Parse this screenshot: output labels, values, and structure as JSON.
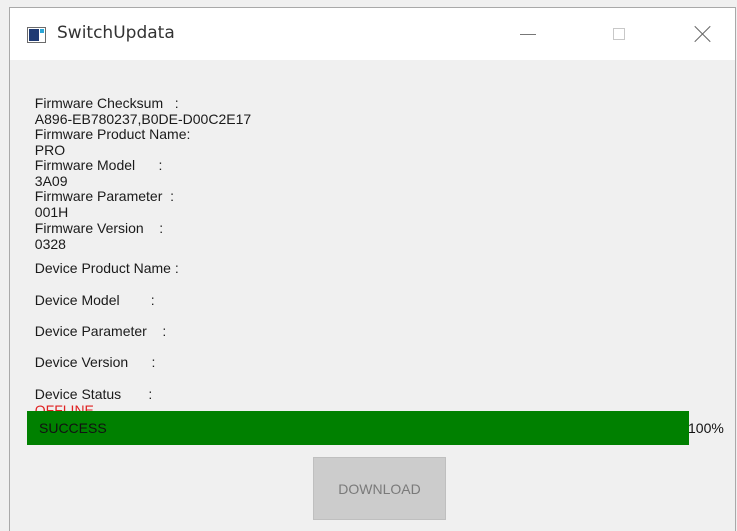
{
  "window": {
    "title": "SwitchUpdata"
  },
  "firmware": {
    "checksum_label": "Firmware Checksum   :",
    "checksum_value": "A896-EB780237,B0DE-D00C2E17",
    "product_label": "Firmware Product Name:",
    "product_value": "PRO",
    "model_label": "Firmware Model      :",
    "model_value": "3A09",
    "parameter_label": "Firmware Parameter  :",
    "parameter_value": "001H",
    "version_label": "Firmware Version    :",
    "version_value": "0328"
  },
  "device": {
    "product_label": "Device Product Name :",
    "product_value": "",
    "model_label": "Device Model        :",
    "model_value": "",
    "parameter_label": "Device Parameter    :",
    "parameter_value": "",
    "version_label": "Device Version      :",
    "version_value": "",
    "status_label": "Device Status       :",
    "status_value": "OFFLINE",
    "status_color": "#e02020"
  },
  "progress": {
    "label": "SUCCESS",
    "percent_text": "100%",
    "value": 1.0,
    "fill_color": "#008000"
  },
  "actions": {
    "download_label": "DOWNLOAD"
  }
}
